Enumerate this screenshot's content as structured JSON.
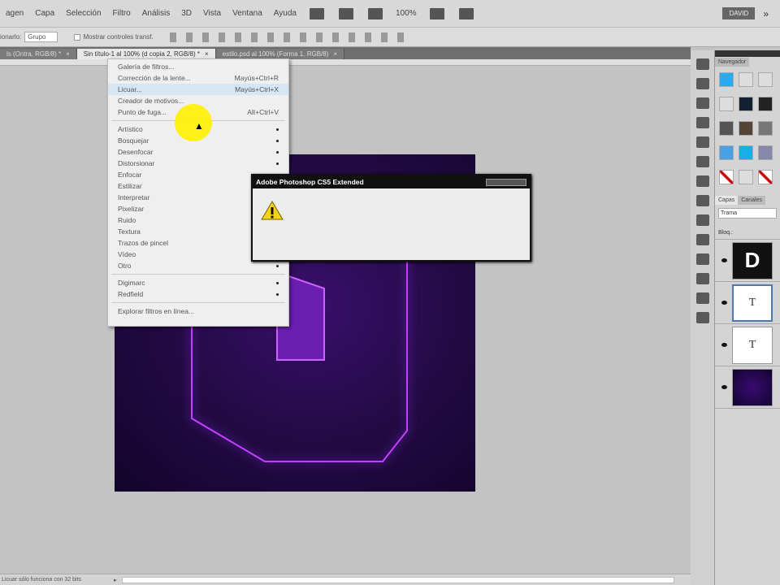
{
  "menubar": {
    "items": [
      "agen",
      "Capa",
      "Selección",
      "Filtro",
      "Análisis",
      "3D",
      "Vista",
      "Ventana",
      "Ayuda"
    ],
    "zoom": "100%",
    "workspace": "DAVID",
    "more": "»"
  },
  "options": {
    "label": "ionarlo:",
    "select": "Grupo",
    "checkbox": "Mostrar controles transf."
  },
  "tabs": [
    "ls (Ontra, RGB/8) *",
    "Sin título-1 al 100% (d copia 2, RGB/8) *",
    "estilo.psd al 100% (Forma 1, RGB/8)"
  ],
  "filter_menu": {
    "items_top": [
      {
        "label": "Galería de filtros..."
      },
      {
        "label": "Corrección de la lente...",
        "shortcut": "Mayús+Ctrl+R"
      },
      {
        "label": "Licuar...",
        "shortcut": "Mayús+Ctrl+X",
        "highlighted": true
      },
      {
        "label": "Creador de motivos..."
      },
      {
        "label": "Punto de fuga...",
        "shortcut": "Alt+Ctrl+V"
      }
    ],
    "submenus": [
      "Artístico",
      "Bosquejar",
      "Desenfocar",
      "Distorsionar",
      "Enfocar",
      "Estilizar",
      "Interpretar",
      "Pixelizar",
      "Ruido",
      "Textura",
      "Trazos de pincel",
      "Vídeo",
      "Otro"
    ],
    "plugins": [
      "Digimarc",
      "Redfield"
    ],
    "browse": "Explorar filtros en línea..."
  },
  "dialog": {
    "title": "Adobe Photoshop CS5 Extended",
    "icon": "warning-icon"
  },
  "panels": {
    "tab_nav": "Navegador",
    "tab_layers": "Capas",
    "tab_channels": "Canales",
    "blend": "Trama",
    "lock": "Bloq.:",
    "layers": [
      {
        "thumb": "D"
      },
      {
        "thumb": "T",
        "selected": true
      },
      {
        "thumb": "T"
      },
      {
        "thumb": ""
      }
    ]
  },
  "status": {
    "text": "Licuar sólo funciona con 32 bits"
  }
}
